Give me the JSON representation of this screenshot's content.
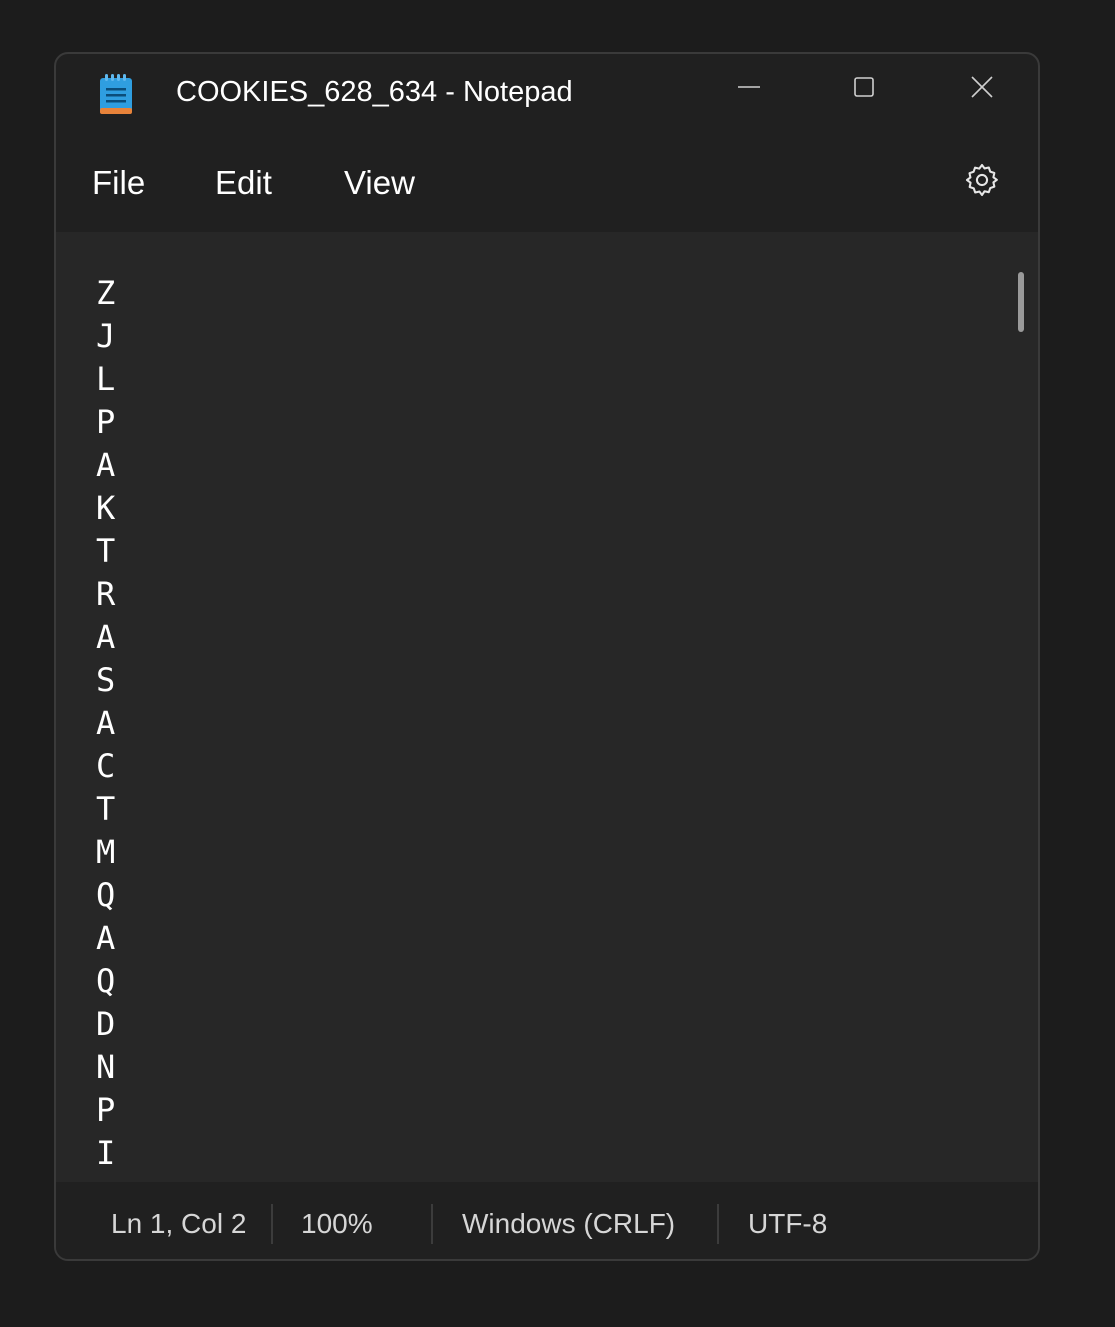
{
  "window": {
    "title": "COOKIES_628_634 - Notepad"
  },
  "caption_buttons": {
    "minimize_icon": "minimize-icon",
    "maximize_icon": "maximize-icon",
    "close_icon": "close-icon"
  },
  "menu": {
    "file_label": "File",
    "edit_label": "Edit",
    "view_label": "View",
    "settings_icon": "gear-icon"
  },
  "editor": {
    "content": "Z\nJ\nL\nP\nA\nK\nT\nR\nA\nS\nA\nC\nT\nM\nQ\nA\nQ\nD\nN\nP\nI"
  },
  "status": {
    "position": "Ln 1, Col 2",
    "zoom": "100%",
    "line_ending": "Windows (CRLF)",
    "encoding": "UTF-8"
  },
  "colors": {
    "background": "#1c1c1c",
    "chrome": "#202020",
    "editor": "#272727",
    "text": "#ffffff",
    "status_text": "#d6d6d6"
  }
}
